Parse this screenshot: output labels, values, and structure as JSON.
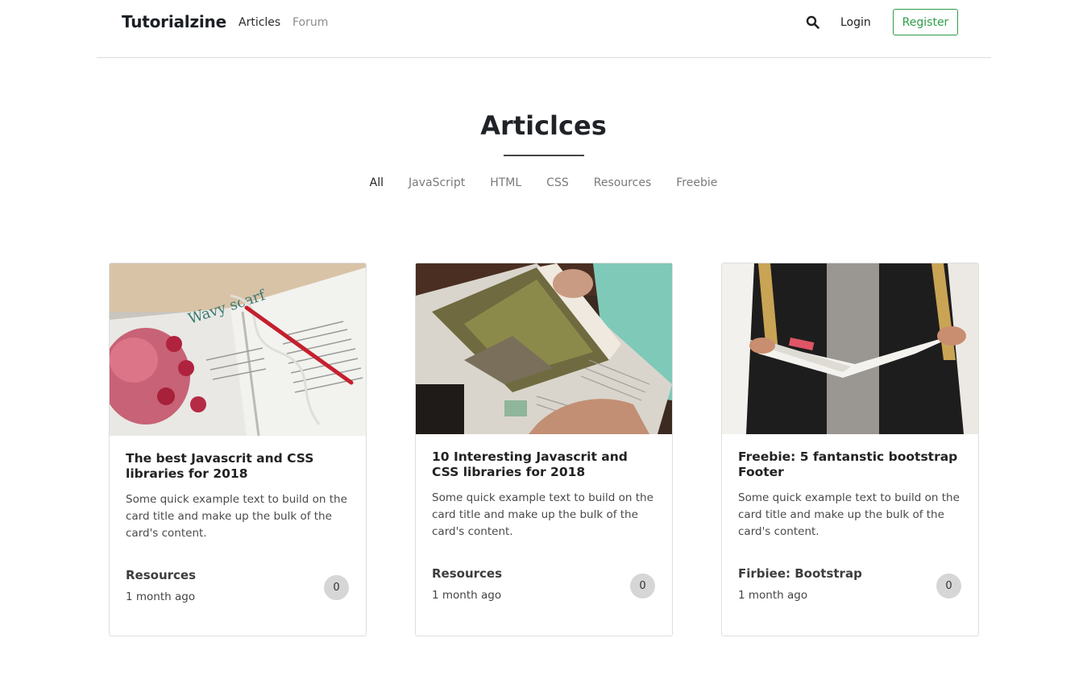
{
  "navbar": {
    "brand": "Tutorialzine",
    "links": [
      {
        "label": "Articles"
      },
      {
        "label": "Forum"
      }
    ],
    "login": "Login",
    "register": "Register"
  },
  "heading": {
    "title": "Articlces"
  },
  "filters": [
    "All",
    "JavaScript",
    "HTML",
    "CSS",
    "Resources",
    "Freebie"
  ],
  "colors": {
    "accent": "#2e9e49",
    "badge": "#d6d6d6"
  },
  "cards": [
    {
      "title": "The best Javascrit and CSS libraries for 2018",
      "text": "Some quick example text to build on the card title and make up the bulk of the card's content.",
      "category": "Resources",
      "time": "1 month ago",
      "comments": "0",
      "image": "open-book-with-pencil-and-yarn"
    },
    {
      "title": "10 Interesting Javascrit and CSS libraries for 2018",
      "text": "Some quick example text to build on the card title and make up the bulk of the card's content.",
      "category": "Resources",
      "time": "1 month ago",
      "comments": "0",
      "image": "hands-holding-magazine-with-landscape"
    },
    {
      "title": "Freebie: 5 fantanstic bootstrap Footer",
      "text": "Some quick example text to build on the card title and make up the bulk of the card's content.",
      "category": "Firbiee: Bootstrap",
      "time": "1 month ago",
      "comments": "0",
      "image": "person-reading-newspaper"
    }
  ]
}
